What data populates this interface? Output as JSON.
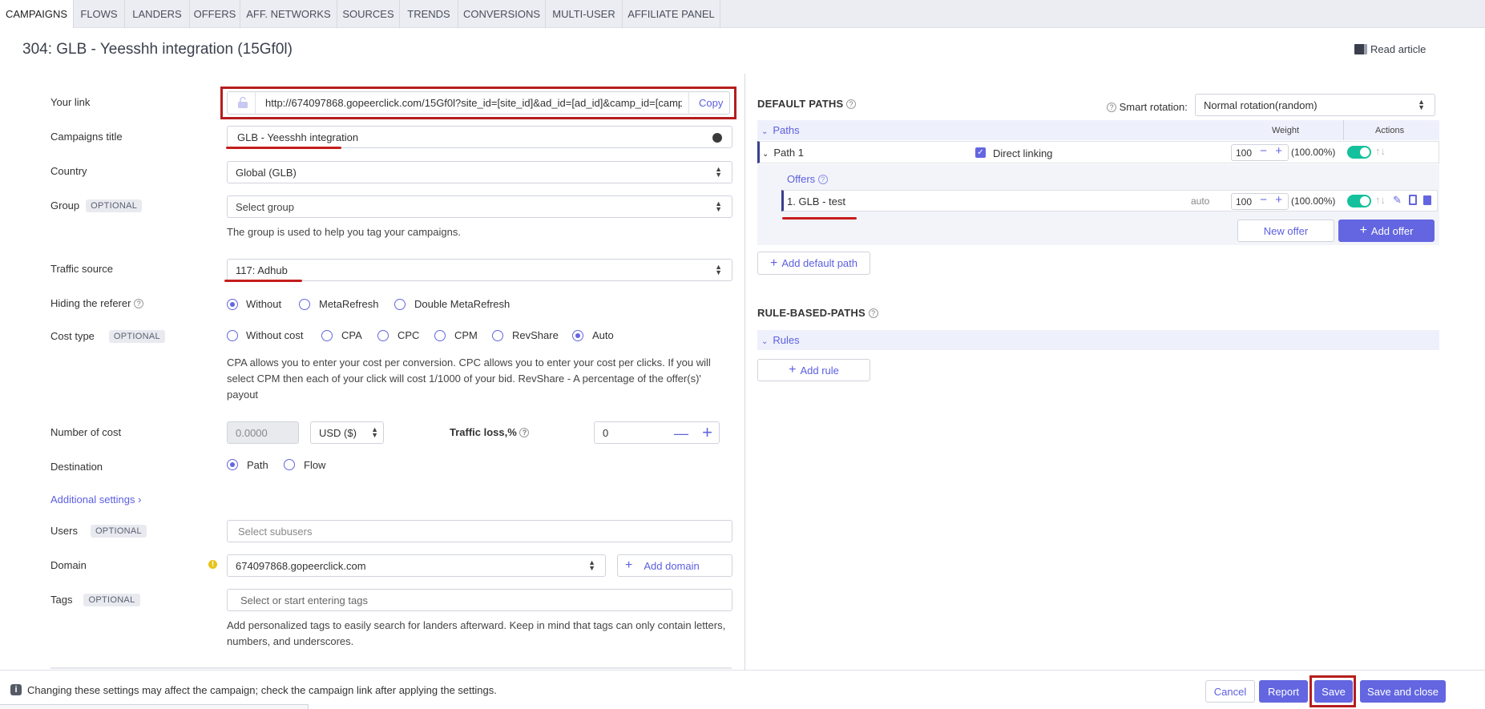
{
  "nav": {
    "tabs": [
      "CAMPAIGNS",
      "FLOWS",
      "LANDERS",
      "OFFERS",
      "AFF. NETWORKS",
      "SOURCES",
      "TRENDS",
      "CONVERSIONS",
      "MULTI-USER",
      "AFFILIATE PANEL"
    ]
  },
  "page": {
    "title": "304: GLB - Yeesshh integration (15Gf0l)",
    "read_article": "Read article"
  },
  "form": {
    "your_link_label": "Your link",
    "your_link_value": "http://674097868.gopeerclick.com/15Gf0l?site_id=[site_id]&ad_id=[ad_id]&camp_id=[camp",
    "copy_label": "Copy",
    "title_label": "Campaigns title",
    "title_value": "GLB - Yeesshh integration",
    "country_label": "Country",
    "country_value": "Global (GLB)",
    "group_label": "Group",
    "optional": "OPTIONAL",
    "group_placeholder": "Select group",
    "group_help": "The group is used to help you tag your campaigns.",
    "traffic_label": "Traffic source",
    "traffic_value": "117: Adhub",
    "hiding_label": "Hiding the referer",
    "hiding_options": [
      "Without",
      "MetaRefresh",
      "Double MetaRefresh"
    ],
    "cost_type_label": "Cost type",
    "cost_options": [
      "Without cost",
      "CPA",
      "CPC",
      "CPM",
      "RevShare",
      "Auto"
    ],
    "cost_help": "CPA allows you to enter your cost per conversion. CPC allows you to enter your cost per clicks. If you will select CPM then each of your click will cost 1/1000 of your bid. RevShare - A percentage of the offer(s)' payout",
    "number_cost_label": "Number of cost",
    "number_cost_value": "0.0000",
    "currency_value": "USD ($)",
    "traffic_loss_label": "Traffic loss,%",
    "traffic_loss_value": "0",
    "destination_label": "Destination",
    "destination_options": [
      "Path",
      "Flow"
    ],
    "additional_settings": "Additional settings",
    "users_label": "Users",
    "users_placeholder": "Select subusers",
    "domain_label": "Domain",
    "domain_value": "674097868.gopeerclick.com",
    "add_domain": "Add domain",
    "tags_label": "Tags",
    "tags_placeholder": "Select or start entering tags",
    "tags_help": "Add personalized tags to easily search for landers afterward. Keep in mind that tags can only contain letters, numbers, and underscores."
  },
  "right": {
    "default_paths": "DEFAULT PATHS",
    "smart_rotation_label": "Smart rotation:",
    "smart_rotation_value": "Normal rotation(random)",
    "paths_header": "Paths",
    "weight_header": "Weight",
    "actions_header": "Actions",
    "path1_name": "Path 1",
    "direct_linking": "Direct linking",
    "path1_weight": "100",
    "path1_pct": "(100.00%)",
    "offers_header": "Offers",
    "offer1_name": "1. GLB - test",
    "offer1_auto": "auto",
    "offer1_weight": "100",
    "offer1_pct": "(100.00%)",
    "new_offer": "New offer",
    "add_offer": "Add offer",
    "add_default_path": "Add default path",
    "rule_based": "RULE-BASED-PATHS",
    "rules_header": "Rules",
    "add_rule": "Add rule"
  },
  "footer": {
    "notice": "Changing these settings may affect the campaign; check the campaign link after applying the settings.",
    "cancel": "Cancel",
    "report": "Report",
    "save": "Save",
    "save_close": "Save and close"
  },
  "colors": {
    "accent": "#6366e0",
    "highlight": "#c51d1d",
    "toggle_on": "#14c19c"
  }
}
